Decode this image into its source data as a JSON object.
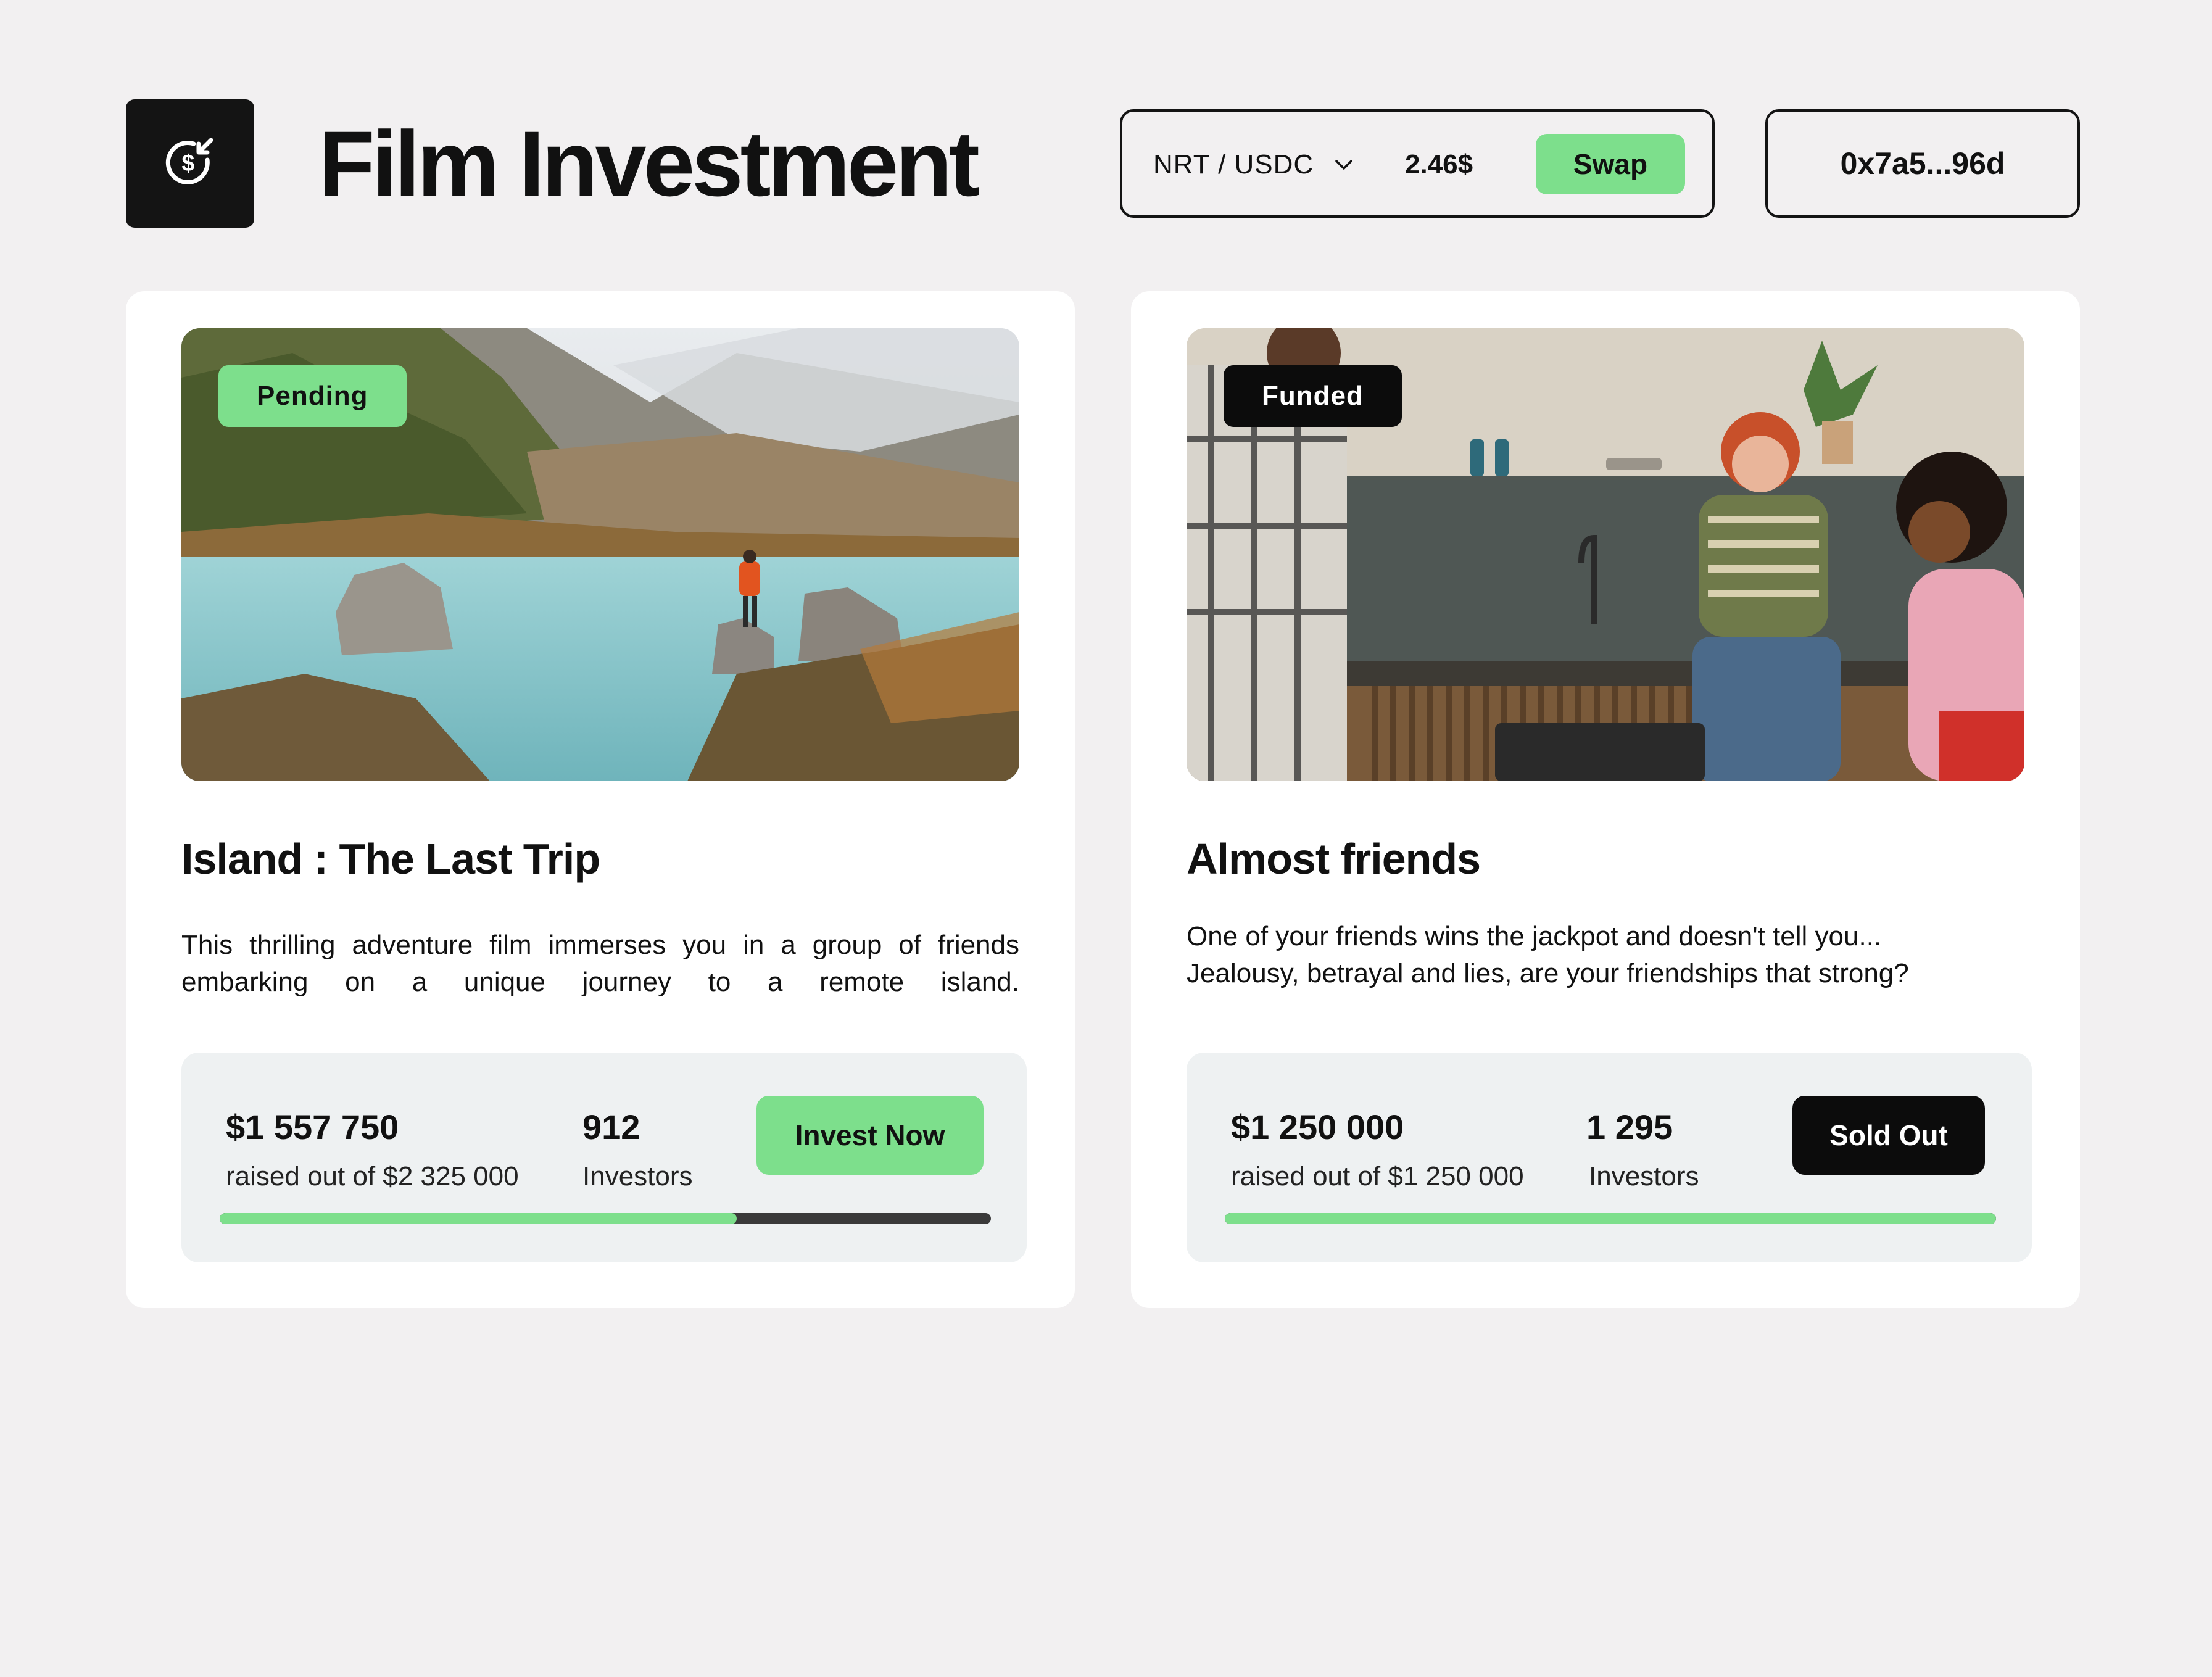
{
  "header": {
    "title": "Film Investment",
    "logo_icon": "dollar-circle-arrow-icon",
    "pair": "NRT / USDC",
    "pair_chevron_icon": "chevron-down-icon",
    "price": "2.46$",
    "swap_label": "Swap",
    "wallet": "0x7a5...96d"
  },
  "colors": {
    "accent": "#7ddf8c",
    "dark": "#0c0c0c",
    "background": "#f2f0f1"
  },
  "films": [
    {
      "status": "Pending",
      "title": "Island : The Last Trip",
      "description": "This thrilling adventure film immerses you in a group of friends embarking on a unique journey to a remote island.",
      "raised": "$1 557 750",
      "raised_label": "raised out of $2 325 000",
      "investors": "912",
      "investors_label": "Investors",
      "action_label": "Invest Now",
      "progress": 0.67
    },
    {
      "status": "Funded",
      "title": "Almost friends",
      "description_lines": [
        "One of your friends wins the jackpot and doesn't tell you...",
        "Jealousy, betrayal and lies, are your friendships that strong?"
      ],
      "raised": "$1 250 000",
      "raised_label": "raised out of $1 250 000",
      "investors": "1 295",
      "investors_label": "Investors",
      "action_label": "Sold Out",
      "progress": 1.0
    }
  ]
}
